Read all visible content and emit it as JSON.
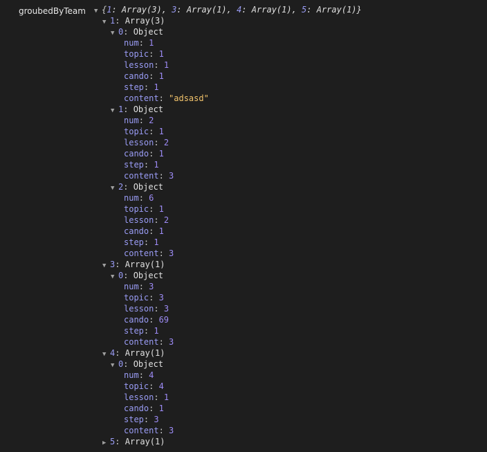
{
  "variable": {
    "name": "groubedByTeam",
    "preview": [
      {
        "key": "1",
        "value": "Array(3)"
      },
      {
        "key": "3",
        "value": "Array(1)"
      },
      {
        "key": "4",
        "value": "Array(1)"
      },
      {
        "key": "5",
        "value": "Array(1)"
      }
    ]
  },
  "groups": [
    {
      "key": "1",
      "label": "Array(3)",
      "expanded": true,
      "items": [
        {
          "index": "0",
          "type": "Object",
          "props": [
            {
              "k": "num",
              "v": "1",
              "kind": "num"
            },
            {
              "k": "topic",
              "v": "1",
              "kind": "num"
            },
            {
              "k": "lesson",
              "v": "1",
              "kind": "num"
            },
            {
              "k": "cando",
              "v": "1",
              "kind": "num"
            },
            {
              "k": "step",
              "v": "1",
              "kind": "num"
            },
            {
              "k": "content",
              "v": "\"adsasd\"",
              "kind": "str"
            }
          ]
        },
        {
          "index": "1",
          "type": "Object",
          "props": [
            {
              "k": "num",
              "v": "2",
              "kind": "num"
            },
            {
              "k": "topic",
              "v": "1",
              "kind": "num"
            },
            {
              "k": "lesson",
              "v": "2",
              "kind": "num"
            },
            {
              "k": "cando",
              "v": "1",
              "kind": "num"
            },
            {
              "k": "step",
              "v": "1",
              "kind": "num"
            },
            {
              "k": "content",
              "v": "3",
              "kind": "num"
            }
          ]
        },
        {
          "index": "2",
          "type": "Object",
          "props": [
            {
              "k": "num",
              "v": "6",
              "kind": "num"
            },
            {
              "k": "topic",
              "v": "1",
              "kind": "num"
            },
            {
              "k": "lesson",
              "v": "2",
              "kind": "num"
            },
            {
              "k": "cando",
              "v": "1",
              "kind": "num"
            },
            {
              "k": "step",
              "v": "1",
              "kind": "num"
            },
            {
              "k": "content",
              "v": "3",
              "kind": "num"
            }
          ]
        }
      ]
    },
    {
      "key": "3",
      "label": "Array(1)",
      "expanded": true,
      "items": [
        {
          "index": "0",
          "type": "Object",
          "props": [
            {
              "k": "num",
              "v": "3",
              "kind": "num"
            },
            {
              "k": "topic",
              "v": "3",
              "kind": "num"
            },
            {
              "k": "lesson",
              "v": "3",
              "kind": "num"
            },
            {
              "k": "cando",
              "v": "69",
              "kind": "num"
            },
            {
              "k": "step",
              "v": "1",
              "kind": "num"
            },
            {
              "k": "content",
              "v": "3",
              "kind": "num"
            }
          ]
        }
      ]
    },
    {
      "key": "4",
      "label": "Array(1)",
      "expanded": true,
      "items": [
        {
          "index": "0",
          "type": "Object",
          "props": [
            {
              "k": "num",
              "v": "4",
              "kind": "num"
            },
            {
              "k": "topic",
              "v": "4",
              "kind": "num"
            },
            {
              "k": "lesson",
              "v": "1",
              "kind": "num"
            },
            {
              "k": "cando",
              "v": "1",
              "kind": "num"
            },
            {
              "k": "step",
              "v": "3",
              "kind": "num"
            },
            {
              "k": "content",
              "v": "3",
              "kind": "num"
            }
          ]
        }
      ]
    },
    {
      "key": "5",
      "label": "Array(1)",
      "expanded": false,
      "items": []
    }
  ],
  "icons": {
    "expanded": "triangle-down-icon",
    "collapsed": "triangle-right-icon"
  }
}
